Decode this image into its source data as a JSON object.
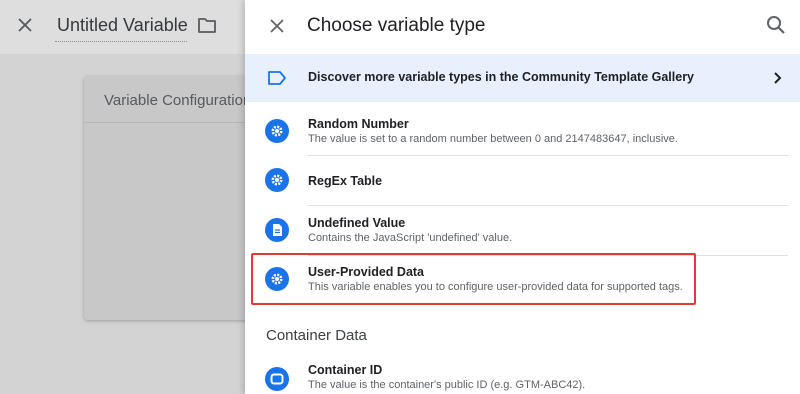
{
  "background": {
    "variable_title": "Untitled Variable",
    "card_title": "Variable Configuration"
  },
  "sheet": {
    "title": "Choose variable type",
    "gallery_link": "Discover more variable types in the Community Template Gallery",
    "items": [
      {
        "name": "Random Number",
        "description": "The value is set to a random number between 0 and 2147483647, inclusive.",
        "icon": "gear-icon"
      },
      {
        "name": "RegEx Table",
        "description": "",
        "icon": "gear-icon"
      },
      {
        "name": "Undefined Value",
        "description": "Contains the JavaScript 'undefined' value.",
        "icon": "document-icon"
      },
      {
        "name": "User-Provided Data",
        "description": "This variable enables you to configure user-provided data for supported tags.",
        "icon": "gear-icon"
      }
    ],
    "section_title": "Container Data",
    "container_items": [
      {
        "name": "Container ID",
        "description": "The value is the container's public ID (e.g. GTM-ABC42).",
        "icon": "container-icon"
      }
    ]
  },
  "colors": {
    "accent": "#1a73e8",
    "gallery_bg": "#e8f0fe",
    "highlight": "#e53935"
  }
}
